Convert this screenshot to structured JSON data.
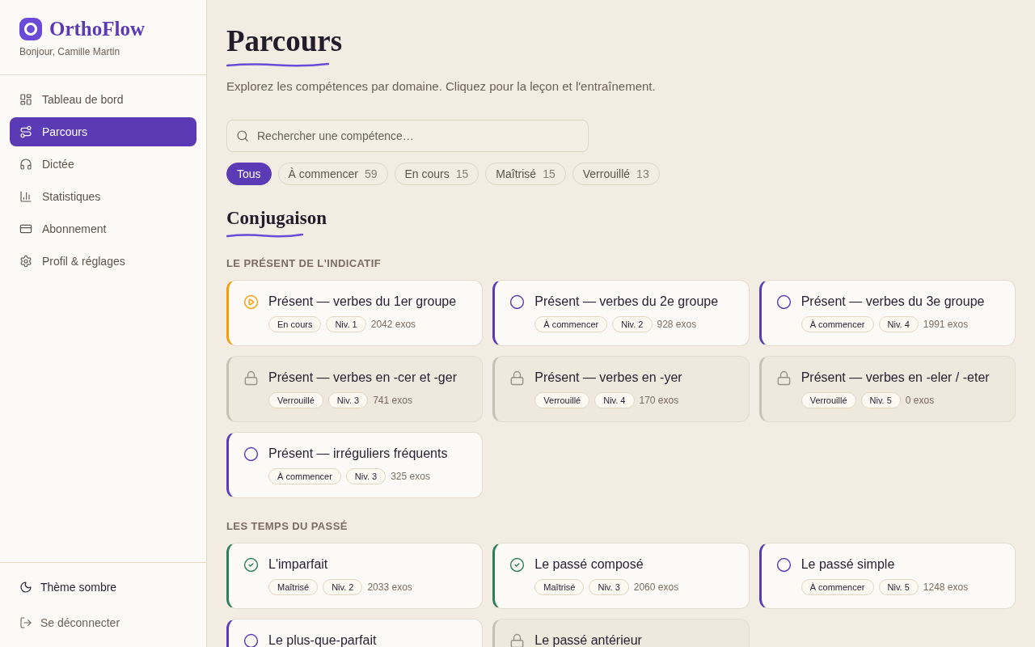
{
  "sidebar": {
    "brand": "OrthoFlow",
    "greeting": "Bonjour, Camille Martin",
    "nav": [
      {
        "label": "Tableau de bord",
        "selected": false
      },
      {
        "label": "Parcours",
        "selected": true
      },
      {
        "label": "Dictée",
        "selected": false
      },
      {
        "label": "Statistiques",
        "selected": false
      },
      {
        "label": "Abonnement",
        "selected": false
      },
      {
        "label": "Profil & réglages",
        "selected": false
      }
    ],
    "footer": [
      {
        "label": "Thème sombre",
        "kind": "theme"
      },
      {
        "label": "Se déconnecter",
        "kind": "logout"
      }
    ]
  },
  "page": {
    "title": "Parcours",
    "subtitle": "Explorez les compétences par domaine. Cliquez pour la leçon et l'entraînement.",
    "search": {
      "placeholder": "Rechercher une compétence…"
    },
    "filters": [
      {
        "label": "Tous",
        "selected": true
      },
      {
        "label": "À commencer",
        "count": "59",
        "selected": false
      },
      {
        "label": "En cours",
        "count": "15",
        "selected": false
      },
      {
        "label": "Maîtrisé",
        "count": "15",
        "selected": false
      },
      {
        "label": "Verrouillé",
        "count": "13",
        "selected": false
      }
    ]
  },
  "domains": [
    {
      "title": "Conjugaison",
      "groups": [
        {
          "label": "LE PRÉSENT DE L'INDICATIF",
          "skills": [
            {
              "title": "Présent — verbes du 1er groupe",
              "kind": "progress",
              "tag": "En cours",
              "difficulty": "Niv. 1",
              "exos": "2042 exos"
            },
            {
              "title": "Présent — verbes du 2e groupe",
              "kind": "todo",
              "tag": "À commencer",
              "difficulty": "Niv. 2",
              "exos": "928 exos"
            },
            {
              "title": "Présent — verbes du 3e groupe",
              "kind": "todo",
              "tag": "À commencer",
              "difficulty": "Niv. 4",
              "exos": "1991 exos"
            },
            {
              "title": "Présent — verbes en -cer et -ger",
              "kind": "locked",
              "tag": "Verrouillé",
              "difficulty": "Niv. 3",
              "exos": "741 exos"
            },
            {
              "title": "Présent — verbes en -yer",
              "kind": "locked",
              "tag": "Verrouillé",
              "difficulty": "Niv. 4",
              "exos": "170 exos"
            },
            {
              "title": "Présent — verbes en -eler / -eter",
              "kind": "locked",
              "tag": "Verrouillé",
              "difficulty": "Niv. 5",
              "exos": "0 exos"
            },
            {
              "title": "Présent — irréguliers fréquents",
              "kind": "todo",
              "tag": "À commencer",
              "difficulty": "Niv. 3",
              "exos": "325 exos"
            }
          ]
        },
        {
          "label": "LES TEMPS DU PASSÉ",
          "skills": [
            {
              "title": "L'imparfait",
              "kind": "mastered",
              "tag": "Maîtrisé",
              "difficulty": "Niv. 2",
              "exos": "2033 exos"
            },
            {
              "title": "Le passé composé",
              "kind": "mastered",
              "tag": "Maîtrisé",
              "difficulty": "Niv. 3",
              "exos": "2060 exos"
            },
            {
              "title": "Le passé simple",
              "kind": "todo",
              "tag": "À commencer",
              "difficulty": "Niv. 5",
              "exos": "1248 exos"
            },
            {
              "title": "Le plus-que-parfait",
              "kind": "todo"
            },
            {
              "title": "Le passé antérieur",
              "kind": "locked"
            }
          ]
        }
      ]
    }
  ]
}
